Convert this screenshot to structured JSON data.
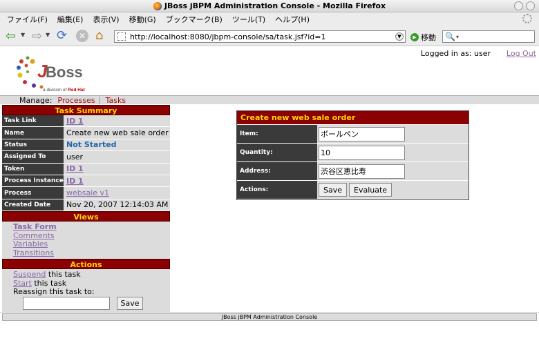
{
  "window": {
    "title": "JBoss jBPM Administration Console - Mozilla Firefox"
  },
  "menu": {
    "items": [
      "ファイル(F)",
      "編集(E)",
      "表示(V)",
      "移動(G)",
      "ブックマーク(B)",
      "ツール(T)",
      "ヘルプ(H)"
    ]
  },
  "toolbar": {
    "url": "http://localhost:8080/jbpm-console/sa/task.jsf?id=1",
    "go_label": "移動"
  },
  "header": {
    "logo_text": "JBoss",
    "logo_sub_prefix": "a division of",
    "logo_sub_brand": "Red Hat",
    "logged_in": "Logged in as: user",
    "logout": "Log Out"
  },
  "manage": {
    "label": "Manage:",
    "links": [
      "Processes",
      "Tasks"
    ]
  },
  "summary": {
    "title": "Task Summary",
    "task_link_label": "Task Link",
    "task_link": "ID 1",
    "name_label": "Name",
    "name": "Create new web sale order",
    "status_label": "Status",
    "status": "Not Started",
    "assigned_label": "Assigned To",
    "assigned": "user",
    "token_label": "Token",
    "token": "ID 1",
    "instance_label": "Process Instance",
    "instance": "ID 1",
    "process_label": "Process",
    "process": "websale v1",
    "created_label": "Created Date",
    "created": "Nov 20, 2007 12:14:03 AM"
  },
  "views": {
    "title": "Views",
    "items": [
      "Task Form",
      "Comments",
      "Variables",
      "Transitions"
    ]
  },
  "actions": {
    "title": "Actions",
    "suspend_link": "Suspend",
    "suspend_text": " this task",
    "start_link": "Start",
    "start_text": " this task",
    "reassign": "Reassign this task to:",
    "save": "Save"
  },
  "form": {
    "title": "Create new web sale order",
    "item_label": "Item:",
    "item_value": "ボールペン",
    "quantity_label": "Quantity:",
    "quantity_value": "10",
    "address_label": "Address:",
    "address_value": "渋谷区恵比寿",
    "actions_label": "Actions:",
    "save": "Save",
    "evaluate": "Evaluate"
  },
  "footer": {
    "text": "JBoss jBPM Administration Console"
  },
  "colors": {
    "header_bg": "#8b0000",
    "header_text": "#ffd700",
    "label_bg": "#3a3a3a",
    "link": "#8866aa"
  }
}
